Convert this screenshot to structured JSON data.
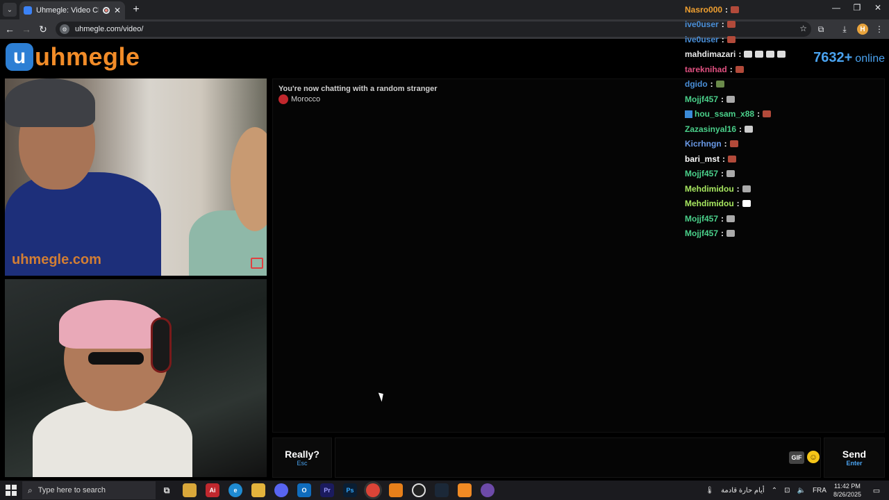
{
  "browser": {
    "tab_title": "Uhmegle: Video Chat | Om",
    "url": "uhmegle.com/video/",
    "window_controls": [
      "—",
      "❐",
      "✕"
    ]
  },
  "site": {
    "logo_text": "uhmegle",
    "online_count": "7632+",
    "online_label": "online",
    "watermark": "uhmegle.com"
  },
  "chat": {
    "status": "You're now chatting with a random stranger",
    "country": "Morocco",
    "really_label": "Really?",
    "really_key": "Esc",
    "gif_label": "GIF",
    "send_label": "Send",
    "send_key": "Enter"
  },
  "overlay_chat": [
    {
      "user": "Nasro000",
      "color": "#f0a030",
      "emotes": [
        "#b24a3a"
      ]
    },
    {
      "user": "ive0user",
      "color": "#4a8fd8",
      "emotes": [
        "#b24a3a"
      ]
    },
    {
      "user": "ive0user",
      "color": "#4a8fd8",
      "emotes": [
        "#b24a3a"
      ]
    },
    {
      "user": "mahdimazari",
      "color": "#e8e8e8",
      "emotes": [
        "#ddd",
        "#ddd",
        "#ddd",
        "#ddd"
      ]
    },
    {
      "user": "tareknihad",
      "color": "#e05080",
      "emotes": [
        "#b24a3a"
      ]
    },
    {
      "user": "dgido",
      "color": "#4a8fd8",
      "emotes": [
        "#6a8a4a"
      ]
    },
    {
      "user": "Mojjf457",
      "color": "#4ad08a",
      "emotes": [
        "#aaa"
      ]
    },
    {
      "user": "hou_ssam_x88",
      "color": "#4ad08a",
      "emotes": [
        "#b24a3a"
      ],
      "badge": true
    },
    {
      "user": "Zazasinyal16",
      "color": "#4ad08a",
      "emotes": [
        "#ccc"
      ]
    },
    {
      "user": "Kicrhngn",
      "color": "#6a9ae8",
      "emotes": [
        "#b24a3a"
      ]
    },
    {
      "user": "bari_mst",
      "color": "#ffffff",
      "emotes": [
        "#b24a3a"
      ]
    },
    {
      "user": "Mojjf457",
      "color": "#4ad08a",
      "emotes": [
        "#aaa"
      ]
    },
    {
      "user": "Mehdimidou",
      "color": "#a8e860",
      "emotes": [
        "#aaa"
      ]
    },
    {
      "user": "Mehdimidou",
      "color": "#a8e860",
      "emotes": [
        "#fff"
      ]
    },
    {
      "user": "Mojjf457",
      "color": "#4ad08a",
      "emotes": [
        "#aaa"
      ]
    },
    {
      "user": "Mojjf457",
      "color": "#4ad08a",
      "emotes": [
        "#aaa"
      ]
    }
  ],
  "taskbar": {
    "search_placeholder": "Type here to search",
    "weather_text": "أيام حارة قادمة",
    "language": "FRA",
    "time": "11:42 PM",
    "date": "8/26/2025"
  },
  "colors": {
    "accent_orange": "#f28c28",
    "accent_blue": "#4aa3f0"
  }
}
